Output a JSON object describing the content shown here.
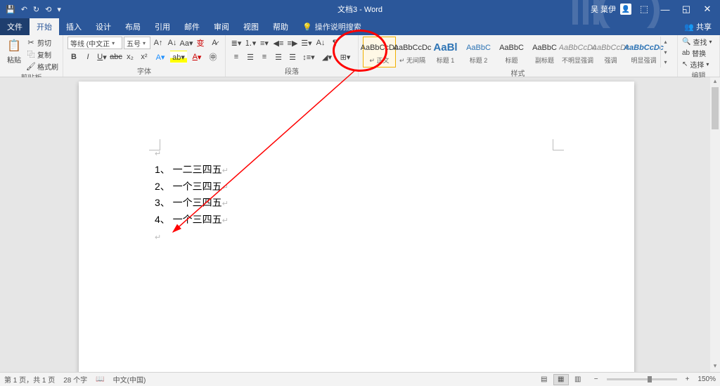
{
  "title": "文档3 - Word",
  "user_name": "吴 葉伊",
  "tabs": {
    "file": "文件",
    "home": "开始",
    "insert": "插入",
    "design": "设计",
    "layout": "布局",
    "references": "引用",
    "mail": "邮件",
    "review": "审阅",
    "view": "视图",
    "help": "帮助",
    "tell_me": "操作说明搜索"
  },
  "share": "共享",
  "clipboard": {
    "paste": "粘贴",
    "cut": "剪切",
    "copy": "复制",
    "format_painter": "格式刷",
    "label": "剪贴板"
  },
  "font": {
    "name": "等线 (中文正",
    "size": "五号",
    "label": "字体"
  },
  "paragraph": {
    "label": "段落"
  },
  "styles": {
    "label": "样式",
    "items": [
      {
        "preview": "AaBbCcDc",
        "name": "↵ 正文",
        "cls": ""
      },
      {
        "preview": "AaBbCcDc",
        "name": "↵ 无间隔",
        "cls": ""
      },
      {
        "preview": "AaBl",
        "name": "标题 1",
        "cls": "big blue"
      },
      {
        "preview": "AaBbC",
        "name": "标题 2",
        "cls": "blue"
      },
      {
        "preview": "AaBbC",
        "name": "标题",
        "cls": ""
      },
      {
        "preview": "AaBbC",
        "name": "副标题",
        "cls": ""
      },
      {
        "preview": "AaBbCcDc",
        "name": "不明显强调",
        "cls": "italic"
      },
      {
        "preview": "AaBbCcDc",
        "name": "强调",
        "cls": "italic"
      },
      {
        "preview": "AaBbCcDc",
        "name": "明显强调",
        "cls": "boldblue"
      }
    ]
  },
  "editing": {
    "find": "查找",
    "replace": "替换",
    "select": "选择",
    "label": "编辑"
  },
  "document": {
    "lines": [
      "1、 一二三四五",
      "2、 一个三四五",
      "3、 一个三四五",
      "4、 一个三四五"
    ]
  },
  "status": {
    "page": "第 1 页，共 1 页",
    "words": "28 个字",
    "lang": "中文(中国)",
    "zoom": "150%"
  }
}
